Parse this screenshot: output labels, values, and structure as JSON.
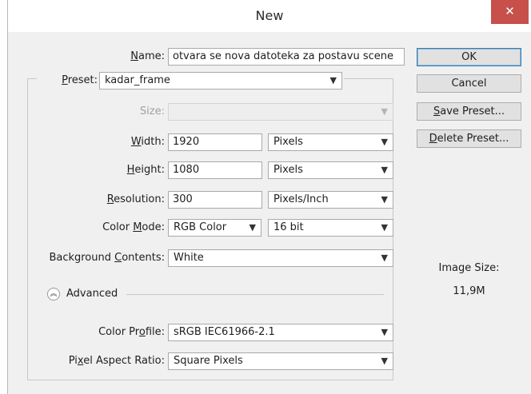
{
  "window": {
    "title": "New",
    "close_glyph": "✕"
  },
  "name": {
    "label_u": "N",
    "label_rest": "ame:",
    "value": "otvara se nova datoteka za postavu scene"
  },
  "preset": {
    "label_u": "P",
    "label_rest": "reset:",
    "value": "kadar_frame"
  },
  "size": {
    "label": "Size:",
    "value": ""
  },
  "width": {
    "label_u": "W",
    "label_rest": "idth:",
    "value": "1920",
    "unit": "Pixels"
  },
  "height": {
    "label_u": "H",
    "label_rest": "eight:",
    "value": "1080",
    "unit": "Pixels"
  },
  "resolution": {
    "label_u": "R",
    "label_rest": "esolution:",
    "value": "300",
    "unit": "Pixels/Inch"
  },
  "color_mode": {
    "label_pre": "Color ",
    "label_u": "M",
    "label_rest": "ode:",
    "mode": "RGB Color",
    "depth": "16 bit"
  },
  "background": {
    "label_pre": "Background ",
    "label_u": "C",
    "label_rest": "ontents:",
    "value": "White"
  },
  "advanced": {
    "label": "Advanced",
    "icon": "chevron-up-double-icon"
  },
  "color_profile": {
    "label_pre": "Color Pr",
    "label_u": "o",
    "label_rest": "file:",
    "value": "sRGB IEC61966-2.1"
  },
  "pixel_aspect": {
    "label_pre": "Pi",
    "label_u": "x",
    "label_rest": "el Aspect Ratio:",
    "value": "Square Pixels"
  },
  "buttons": {
    "ok": "OK",
    "cancel": "Cancel",
    "save_u": "S",
    "save_rest": "ave Preset...",
    "delete_u": "D",
    "delete_rest": "elete Preset..."
  },
  "image_size": {
    "label": "Image Size:",
    "value": "11,9M"
  },
  "colors": {
    "close_button": "#c7504b",
    "dialog_bg": "#f0f0f0",
    "default_button_border": "#3c7fb1"
  }
}
